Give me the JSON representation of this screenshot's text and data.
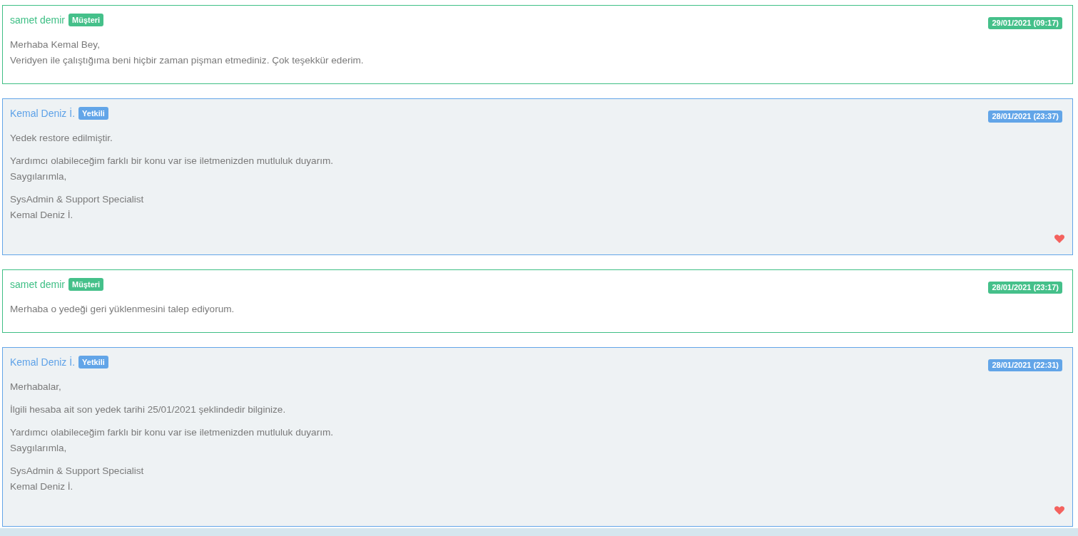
{
  "messages": [
    {
      "kind": "customer",
      "author": "samet demir",
      "role": "Müşteri",
      "date": "29/01/2021 (09:17)",
      "paragraphs": [
        "Merhaba Kemal Bey,\nVeridyen ile çalıştığıma beni hiçbir zaman pişman etmediniz. Çok teşekkür ederim."
      ],
      "liked": false
    },
    {
      "kind": "staff",
      "author": "Kemal Deniz İ.",
      "role": "Yetkili",
      "date": "28/01/2021 (23:37)",
      "paragraphs": [
        "Yedek restore edilmiştir.",
        "Yardımcı olabileceğim farklı bir konu var ise iletmenizden mutluluk duyarım.\nSaygılarımla,",
        "SysAdmin & Support Specialist\nKemal Deniz İ."
      ],
      "liked": true
    },
    {
      "kind": "customer",
      "author": "samet demir",
      "role": "Müşteri",
      "date": "28/01/2021 (23:17)",
      "paragraphs": [
        "Merhaba o yedeği geri yüklenmesini talep ediyorum."
      ],
      "liked": false
    },
    {
      "kind": "staff",
      "author": "Kemal Deniz İ.",
      "role": "Yetkili",
      "date": "28/01/2021 (22:31)",
      "paragraphs": [
        "Merhabalar,",
        "İlgili hesaba ait son yedek tarihi 25/01/2021 şeklindedir bilginize.",
        "Yardımcı olabileceğim farklı bir konu var ise iletmenizden mutluluk duyarım.\nSaygılarımla,",
        "SysAdmin & Support Specialist\nKemal Deniz İ."
      ],
      "liked": true
    }
  ]
}
